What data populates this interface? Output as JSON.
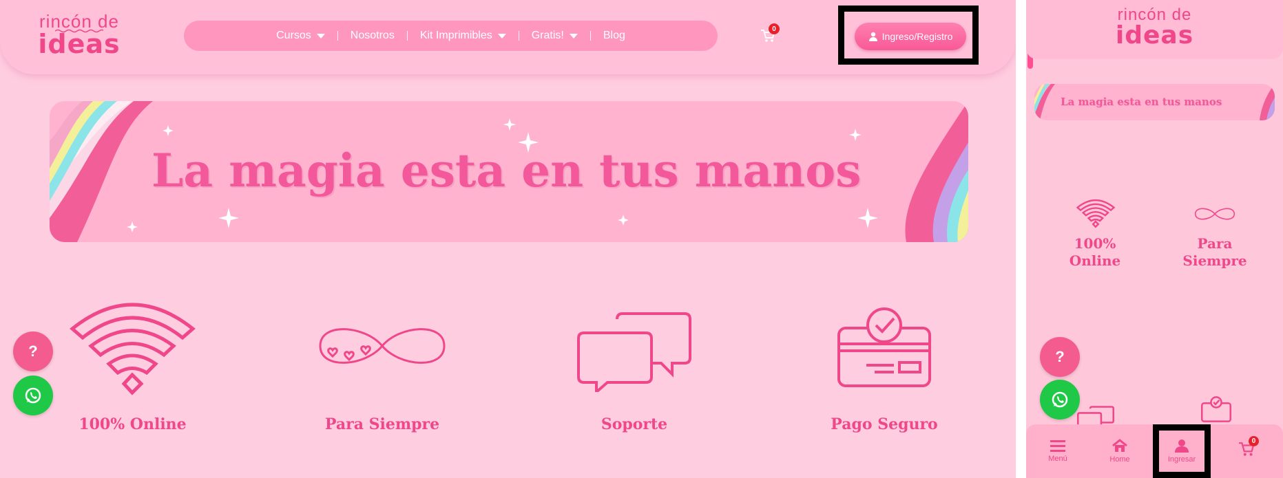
{
  "brand": {
    "logo_line1": "rincón de",
    "logo_line2": "ideas"
  },
  "nav": {
    "items": [
      {
        "label": "Cursos",
        "has_dropdown": true
      },
      {
        "label": "Nosotros",
        "has_dropdown": false
      },
      {
        "label": "Kit Imprimibles",
        "has_dropdown": true
      },
      {
        "label": "Gratis!",
        "has_dropdown": true
      },
      {
        "label": "Blog",
        "has_dropdown": false
      }
    ]
  },
  "cart": {
    "count": "0"
  },
  "login": {
    "label": "Ingreso/Registro"
  },
  "banner": {
    "text": "La magia esta en tus manos"
  },
  "features": [
    {
      "icon": "wifi-icon",
      "label": "100% Online"
    },
    {
      "icon": "infinity-icon",
      "label": "Para Siempre"
    },
    {
      "icon": "chat-bubbles-icon",
      "label": "Soporte"
    },
    {
      "icon": "card-check-icon",
      "label": "Pago Seguro"
    }
  ],
  "mobile": {
    "feature_labels": [
      "100%\nOnline",
      "Para\nSiempre"
    ],
    "bottom_nav": [
      {
        "icon": "menu-icon",
        "label": "Menú"
      },
      {
        "icon": "home-icon",
        "label": "Home"
      },
      {
        "icon": "user-icon",
        "label": "Ingresar"
      },
      {
        "icon": "cart-icon",
        "label": ""
      }
    ]
  },
  "fabs": {
    "help_label": "?",
    "whatsapp_icon": "whatsapp-icon"
  },
  "colors": {
    "accent": "#f0468a",
    "background": "#ffcde0",
    "button": "#f85a97",
    "whatsapp": "#20c848",
    "badge": "#e8202c"
  }
}
